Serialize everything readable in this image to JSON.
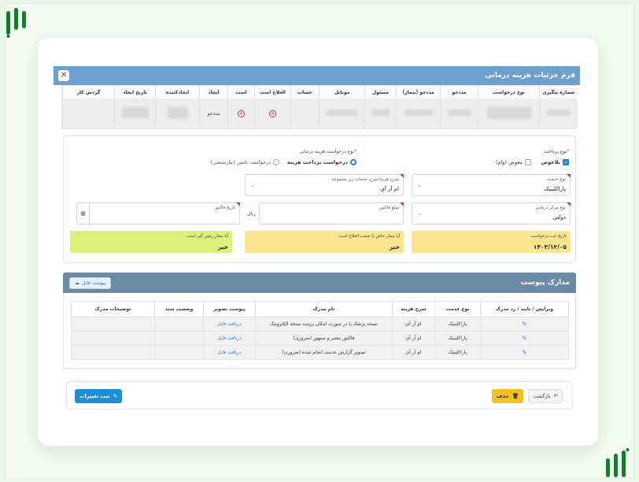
{
  "window": {
    "title": "فرم جزئیات هزینه درمانی",
    "close_label": "✕"
  },
  "top_table": {
    "columns": [
      "شماره پیگیری",
      "نوع درخواست",
      "مددجو",
      "مددجو (بیمار)",
      "مسئول",
      "موبایل",
      "حساب",
      "العلاج است",
      "است",
      "ایجاد",
      "ایجادکننده",
      "تاریخ ایجاد",
      "گردش کار"
    ],
    "row": {
      "ijad": "مددجو"
    }
  },
  "form": {
    "payment_type_label": "نوع پرداخت",
    "payment_options": [
      "بلاعوض",
      "معوض (وام)"
    ],
    "request_type_label": "نوع درخواست هزینه درمانی",
    "request_options": [
      "درخواست پرداخت هزینه",
      "درخواست تامین (نیازسنجی)"
    ],
    "service_type": {
      "label": "نوع خدمت",
      "value": "پاراکلینیک"
    },
    "cost_desc": {
      "label": "شرح هزینه/شرح خدمات زیر مجموعه",
      "value": "ام آر آی"
    },
    "center_type": {
      "label": "نوع مرکز درمانی",
      "value": "دولتی"
    },
    "invoice_amount": {
      "label": "مبلغ فاکتور",
      "unit": "ریال"
    },
    "invoice_date": {
      "label": "تاریخ فاکتور"
    },
    "request_date": {
      "label": "تاریخ ثبت درخواست",
      "value": "۱۴۰۳/۱۲/۰۵"
    },
    "incurable": {
      "label": "آیا بیمار خاص یا صعب العلاج است",
      "value": "خیر"
    },
    "bedridden": {
      "label": "آیا بیمار زمین گیر است",
      "value": "خیر"
    }
  },
  "documents": {
    "title": "مدارک پیوست",
    "attach_label": "پیوست فایل",
    "columns": [
      "ویرایش / تایید / رد مدرک",
      "نوع خدمت",
      "شرح هزینه",
      "نام مدرک",
      "پیوست تصویر",
      "وضعیت سند",
      "توضیحات مدرک"
    ],
    "rows": [
      {
        "service": "پاراکلینیک",
        "cost": "ام آر آی",
        "name": "نسخه پزشک یا در صورت امکان پرینت نسخه الکترونیک",
        "attachment": "دریافت فایل",
        "status": "",
        "notes": ""
      },
      {
        "service": "پاراکلینیک",
        "cost": "ام آر آی",
        "name": "فاکتور معتبر و ممهور (ضروری)",
        "attachment": "دریافت فایل",
        "status": "",
        "notes": ""
      },
      {
        "service": "پاراکلینیک",
        "cost": "ام آر آی",
        "name": "تصویر گزارش خدمت انجام شده (ضروری)",
        "attachment": "دریافت فایل",
        "status": "",
        "notes": ""
      }
    ]
  },
  "footer": {
    "back_label": "بازگشت",
    "delete_label": "حذف",
    "save_label": "ثبت تغییرات"
  },
  "colors": {
    "header": "#6d9fcf",
    "docs_header": "#6b8aa6",
    "yellow": "#fbe58e",
    "green": "#ddf07a",
    "accent": "#1e8fd6",
    "delete": "#f4c024"
  }
}
